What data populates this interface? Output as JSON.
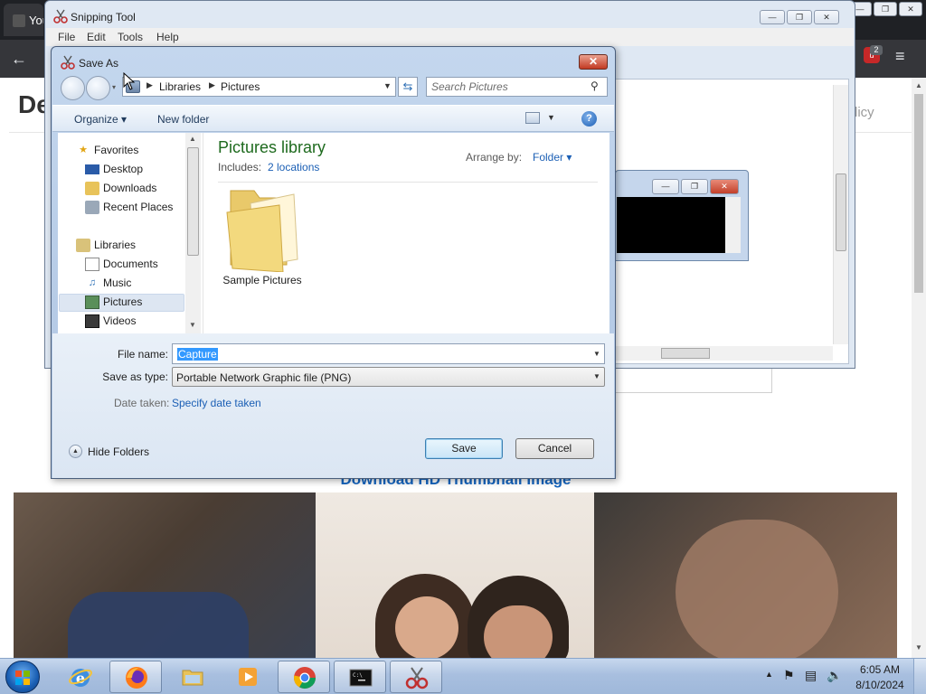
{
  "browser": {
    "tab_title_partial": "You",
    "page_heading_partial": "De",
    "page_nav_partial": "licy",
    "download_link": "Download HD Thumbnail Image",
    "extension_badge": "2",
    "back_icon": "arrow-left-icon",
    "menu_icon": "hamburger-menu-icon"
  },
  "snipping_tool": {
    "title": "Snipping Tool",
    "menu": [
      "File",
      "Edit",
      "Tools",
      "Help"
    ]
  },
  "save_dialog": {
    "title": "Save As",
    "breadcrumb": [
      "Libraries",
      "Pictures"
    ],
    "search_placeholder": "Search Pictures",
    "toolbar": {
      "organize": "Organize",
      "new_folder": "New folder"
    },
    "nav": {
      "favorites_header": "Favorites",
      "favorites": [
        "Desktop",
        "Downloads",
        "Recent Places"
      ],
      "libraries_header": "Libraries",
      "libraries": [
        "Documents",
        "Music",
        "Pictures",
        "Videos"
      ],
      "selected": "Pictures"
    },
    "content": {
      "library_title": "Pictures library",
      "includes_label": "Includes:",
      "includes_link": "2 locations",
      "arrange_label": "Arrange by:",
      "arrange_value": "Folder",
      "items": [
        {
          "name": "Sample Pictures",
          "type": "folder"
        }
      ]
    },
    "form": {
      "file_name_label": "File name:",
      "file_name_value": "Capture",
      "save_as_type_label": "Save as type:",
      "save_as_type_value": "Portable Network Graphic file (PNG)",
      "date_taken_label": "Date taken:",
      "date_taken_link": "Specify date taken"
    },
    "buttons": {
      "hide_folders": "Hide Folders",
      "save": "Save",
      "cancel": "Cancel"
    }
  },
  "taskbar": {
    "apps": [
      "start",
      "internet-explorer",
      "firefox",
      "file-explorer",
      "media-player",
      "chrome",
      "command-prompt",
      "snipping-tool"
    ],
    "time": "6:05 AM",
    "date": "8/10/2024"
  },
  "colors": {
    "dialog_frame": "#c4d7ee",
    "link_blue": "#1b5fb5",
    "library_green": "#1e6a1e",
    "selection_blue": "#3399ff",
    "close_red": "#c23a22"
  }
}
